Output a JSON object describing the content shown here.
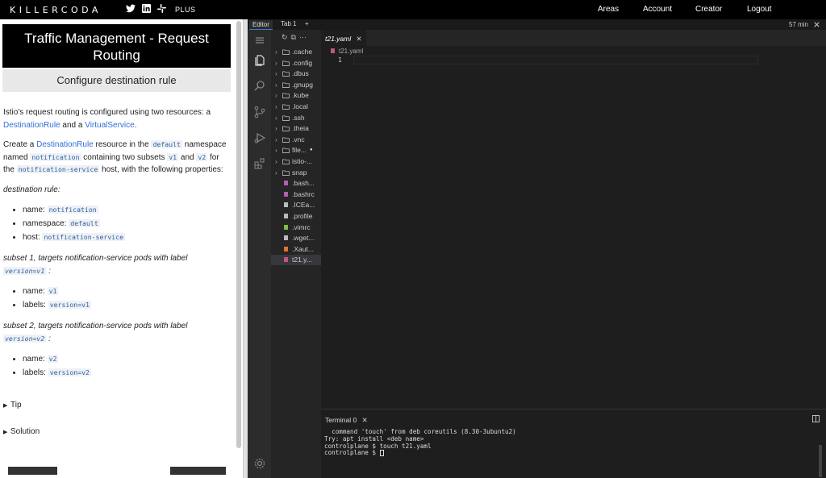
{
  "topnav": {
    "logo": "KILLERCODA",
    "social": [
      "twitter-icon",
      "linkedin-icon",
      "slack-icon"
    ],
    "plus": "PLUS",
    "links": [
      "Areas",
      "Account",
      "Creator",
      "Logout"
    ]
  },
  "scenario": {
    "title": "Traffic Management - Request Routing",
    "step_title": "Configure destination rule",
    "intro_1": "Istio's request routing is configured using two resources: a ",
    "intro_link1": "DestinationRule",
    "intro_2": " and a ",
    "intro_link2": "VirtualService",
    "intro_3": ".",
    "create_1": "Create a ",
    "create_link": "DestinationRule",
    "create_2": " resource in the ",
    "create_code1": "default",
    "create_3": " namespace named ",
    "create_code2": "notification",
    "create_4": " containing two subsets ",
    "create_code3": "v1",
    "create_5": " and ",
    "create_code4": "v2",
    "create_6": " for the ",
    "create_code5": "notification-service",
    "create_7": " host, with the following properties:",
    "dr_heading": "destination rule:",
    "dr_items": [
      {
        "label": "name: ",
        "value": "notification"
      },
      {
        "label": "namespace: ",
        "value": "default"
      },
      {
        "label": "host: ",
        "value": "notification-service"
      }
    ],
    "subset1_heading": "subset 1, targets notification-service pods with label",
    "subset1_code": "version=v1",
    "subset1_colon": " :",
    "subset1_items": [
      {
        "label": "name: ",
        "value": "v1"
      },
      {
        "label": "labels: ",
        "value": "version=v1"
      }
    ],
    "subset2_heading": "subset 2, targets notification-service pods with label",
    "subset2_code": "version=v2",
    "subset2_colon": " :",
    "subset2_items": [
      {
        "label": "name: ",
        "value": "v2"
      },
      {
        "label": "labels: ",
        "value": "version=v2"
      }
    ],
    "tip": "Tip",
    "solution": "Solution"
  },
  "ide": {
    "tabs": [
      "Editor",
      "Tab 1",
      "+"
    ],
    "timer": "57 min",
    "explorer": [
      {
        "type": "folder",
        "name": ".cache"
      },
      {
        "type": "folder",
        "name": ".config"
      },
      {
        "type": "folder",
        "name": ".dbus"
      },
      {
        "type": "folder",
        "name": ".gnupg"
      },
      {
        "type": "folder",
        "name": ".kube"
      },
      {
        "type": "folder",
        "name": ".local"
      },
      {
        "type": "folder",
        "name": ".ssh"
      },
      {
        "type": "folder",
        "name": ".theia"
      },
      {
        "type": "folder",
        "name": ".vnc"
      },
      {
        "type": "folder",
        "name": "file..."
      },
      {
        "type": "folder",
        "name": "istio-..."
      },
      {
        "type": "folder",
        "name": "snap"
      },
      {
        "type": "file",
        "name": ".bash...",
        "color": "#b05fb5"
      },
      {
        "type": "file",
        "name": ".bashrc",
        "color": "#b05fb5"
      },
      {
        "type": "file",
        "name": ".ICEa...",
        "color": "#bbbbbb"
      },
      {
        "type": "file",
        "name": ".profile",
        "color": "#bbbbbb"
      },
      {
        "type": "file",
        "name": ".vimrc",
        "color": "#7fbf3f"
      },
      {
        "type": "file",
        "name": ".wget...",
        "color": "#bbbbbb"
      },
      {
        "type": "file",
        "name": ".Xaut...",
        "color": "#e0743a"
      },
      {
        "type": "file",
        "name": "t21.y...",
        "color": "#c2577b"
      }
    ],
    "editor_tab": "t21.yaml",
    "breadcrumb": "t21.yaml",
    "line_number": "1",
    "terminal_tab": "Terminal 0",
    "terminal_lines": [
      "  command 'touch' from deb coreutils (8.30-3ubuntu2)",
      "",
      "Try: apt install <deb name>",
      "",
      "controlplane $ touch t21.yaml",
      "controlplane $ "
    ]
  }
}
